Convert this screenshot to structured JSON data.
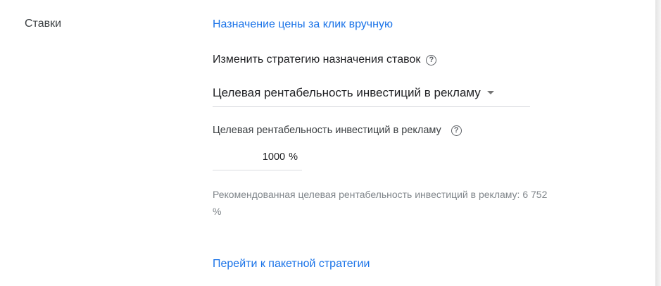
{
  "section": {
    "label": "Ставки"
  },
  "links": {
    "manual_cpc": "Назначение цены за клик вручную",
    "portfolio_strategy": "Перейти к пакетной стратегии"
  },
  "strategy": {
    "heading": "Изменить стратегию назначения ставок",
    "selected": "Целевая рентабельность инвестиций в рекламу"
  },
  "target_roas": {
    "label": "Целевая рентабельность инвестиций в рекламу",
    "value": "1000",
    "unit": "%",
    "recommendation": "Рекомендованная целевая рентабельность инвестиций в рекламу: 6 752 %"
  },
  "icons": {
    "help": "help-circle-icon",
    "dropdown": "arrow-drop-down-icon",
    "help_glyph": "?"
  },
  "colors": {
    "link": "#1a73e8",
    "text": "#202124",
    "muted": "#80868b",
    "divider": "#dadce0"
  }
}
